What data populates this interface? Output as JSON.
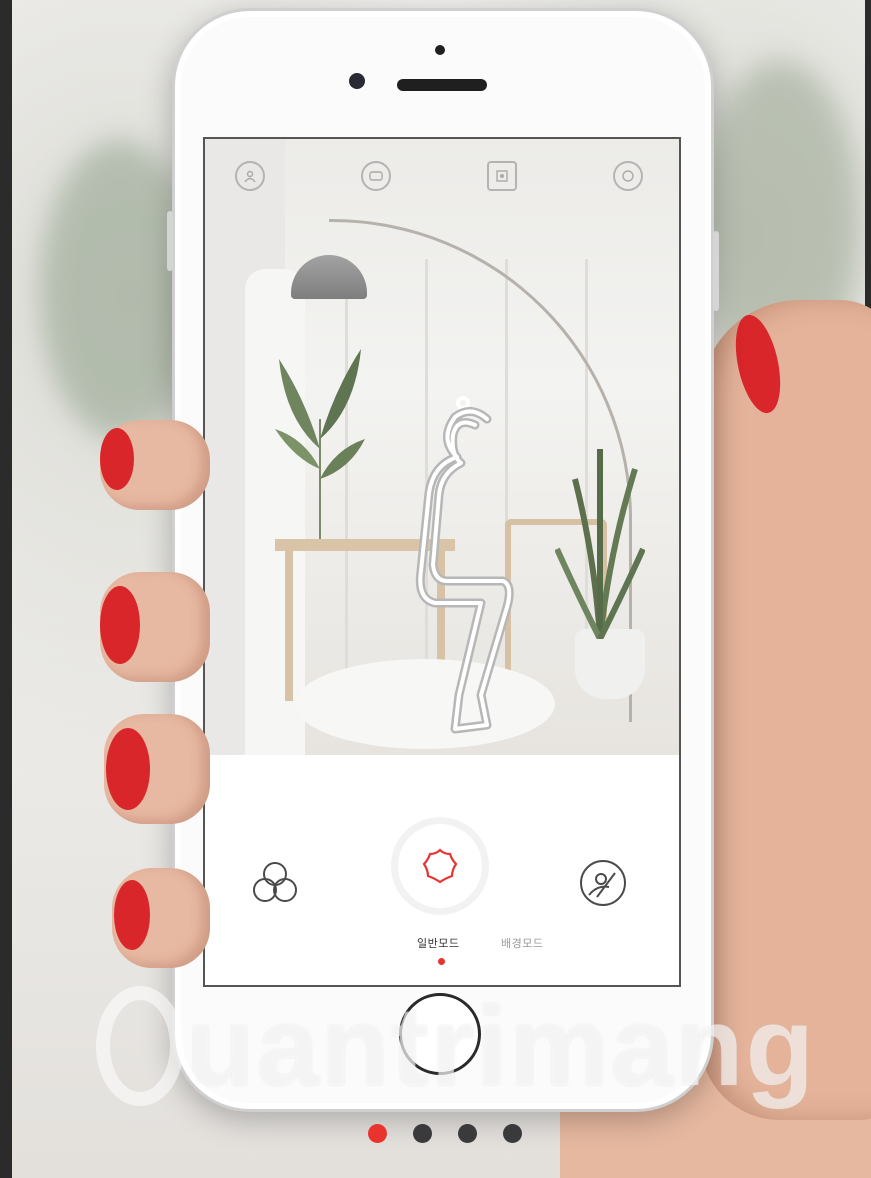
{
  "app": {
    "camera": {
      "modes": [
        {
          "label": "일반모드",
          "active": true
        },
        {
          "label": "배경모드",
          "active": false
        }
      ],
      "top_icons": [
        "person-icon",
        "ratio-icon",
        "frame-icon",
        "timer-icon"
      ],
      "bottom_icons": {
        "left": "filter-circles-icon",
        "center": "shutter-hexagon-icon",
        "right": "pose-guide-icon"
      }
    },
    "pager": {
      "total": 4,
      "active_index": 0
    },
    "watermark": {
      "text": "uantrimang"
    },
    "colors": {
      "accent": "#e8332e",
      "nail": "#d8262b",
      "pager_inactive": "#3a3a3c"
    }
  }
}
